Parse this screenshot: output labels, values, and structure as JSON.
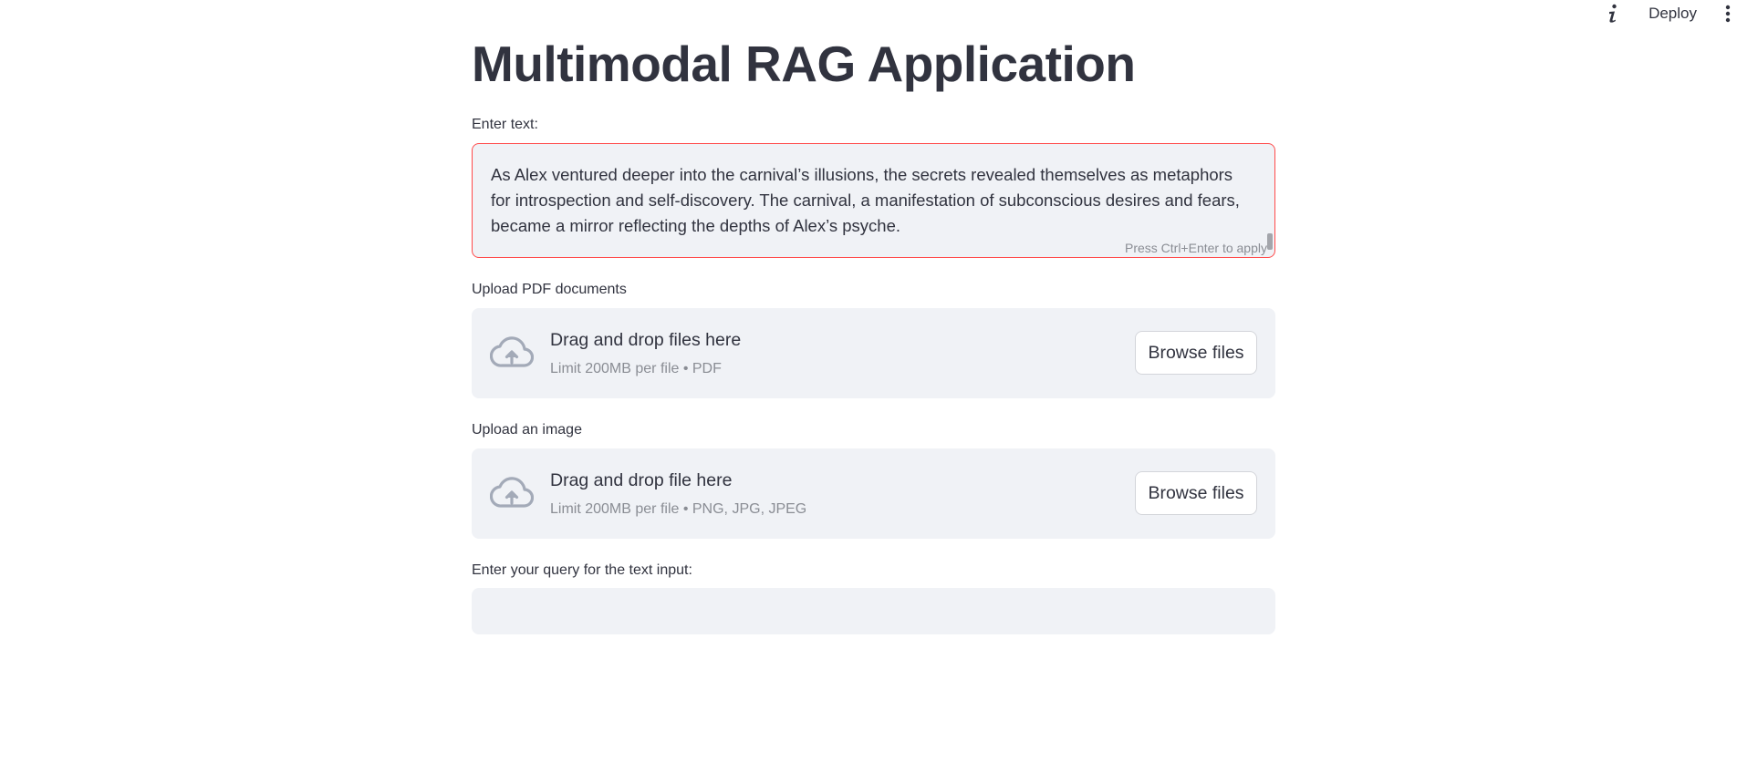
{
  "topbar": {
    "info_icon": "info-icon",
    "deploy_label": "Deploy",
    "more_icon": "vertical-dots-icon"
  },
  "page": {
    "title": "Multimodal RAG Application"
  },
  "text_input": {
    "label": "Enter text:",
    "value": "As Alex ventured deeper into the carnival’s illusions, the secrets revealed themselves as metaphors for introspection and self-discovery. The carnival, a manifestation of subconscious desires and fears, became a mirror reflecting the depths of Alex’s psyche.",
    "hint": "Press Ctrl+Enter to apply"
  },
  "pdf_upload": {
    "label": "Upload PDF documents",
    "title": "Drag and drop files here",
    "subtitle": "Limit 200MB per file • PDF",
    "button": "Browse files",
    "icon": "cloud-upload-icon"
  },
  "image_upload": {
    "label": "Upload an image",
    "title": "Drag and drop file here",
    "subtitle": "Limit 200MB per file • PNG, JPG, JPEG",
    "button": "Browse files",
    "icon": "cloud-upload-icon"
  },
  "query": {
    "label": "Enter your query for the text input:",
    "value": "",
    "placeholder": ""
  },
  "colors": {
    "accent_border": "#ff4b4b",
    "input_bg": "#f0f2f6",
    "text": "#31333f",
    "muted": "#8a8d94",
    "icon": "#a3aab8"
  }
}
